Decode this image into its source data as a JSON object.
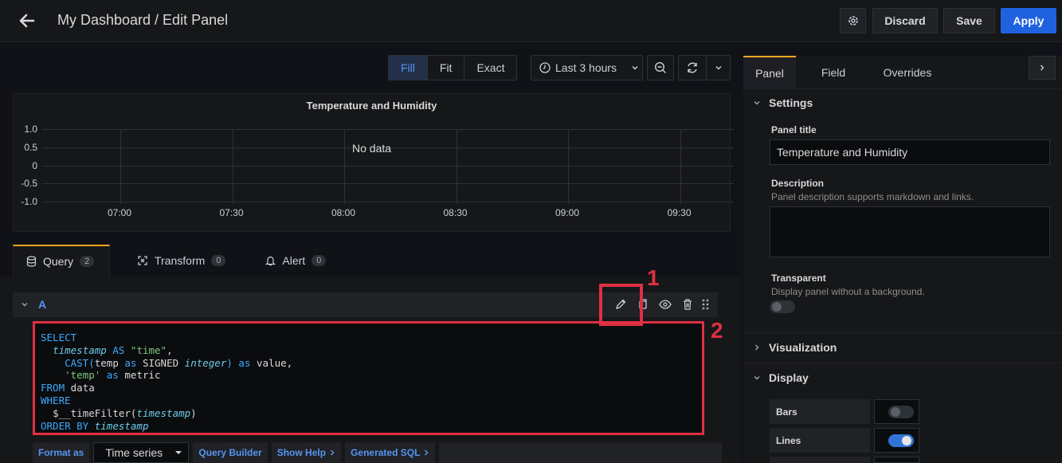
{
  "header": {
    "title": "My Dashboard / Edit Panel",
    "discard": "Discard",
    "save": "Save",
    "apply": "Apply"
  },
  "toolbar": {
    "fit_options": [
      "Fill",
      "Fit",
      "Exact"
    ],
    "time_range": "Last 3 hours"
  },
  "panel": {
    "title": "Temperature and Humidity",
    "no_data": "No data"
  },
  "chart_data": {
    "type": "line",
    "title": "Temperature and Humidity",
    "x": [
      "07:00",
      "07:30",
      "08:00",
      "08:30",
      "09:00",
      "09:30"
    ],
    "yticks": [
      "1.0",
      "0.5",
      "0",
      "-0.5",
      "-1.0"
    ],
    "ylim": [
      -1.0,
      1.0
    ],
    "series": [],
    "grid": true
  },
  "tabs": [
    {
      "label": "Query",
      "count": "2"
    },
    {
      "label": "Transform",
      "count": "0"
    },
    {
      "label": "Alert",
      "count": "0"
    }
  ],
  "query": {
    "letter": "A",
    "format_label": "Format as",
    "format_value": "Time series",
    "query_builder": "Query Builder",
    "show_help": "Show Help",
    "generated_sql": "Generated SQL"
  },
  "annotations": {
    "one": "1",
    "two": "2"
  },
  "options": {
    "tabs": [
      "Panel",
      "Field",
      "Overrides"
    ],
    "settings": "Settings",
    "panel_title_label": "Panel title",
    "panel_title_value": "Temperature and Humidity",
    "description_label": "Description",
    "description_help": "Panel description supports markdown and links.",
    "transparent_label": "Transparent",
    "transparent_help": "Display panel without a background.",
    "transparent_on": false,
    "visualization": "Visualization",
    "display": "Display",
    "bars_label": "Bars",
    "bars_on": false,
    "lines_label": "Lines",
    "lines_on": true
  }
}
